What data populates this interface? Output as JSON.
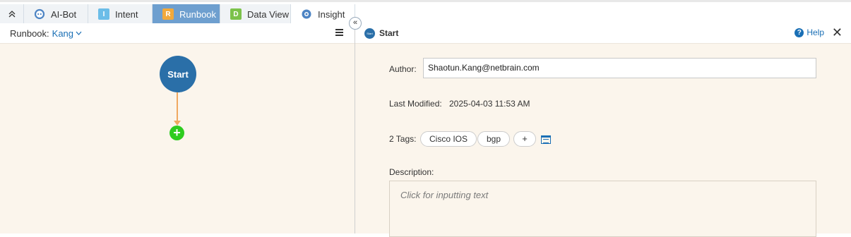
{
  "tabs": [
    {
      "label": "AI-Bot",
      "icon": "ai-bot-icon"
    },
    {
      "label": "Intent",
      "icon": "intent-icon",
      "badge": "I"
    },
    {
      "label": "Runbook",
      "icon": "runbook-icon",
      "badge": "R"
    },
    {
      "label": "Data View",
      "icon": "data-view-icon",
      "badge": "D"
    },
    {
      "label": "Insight",
      "icon": "insight-icon"
    }
  ],
  "left": {
    "runbook_label": "Runbook:",
    "runbook_value": "Kang",
    "start_node": "Start",
    "add_node": "+"
  },
  "right": {
    "title": "Start",
    "small_icon_text": "Start",
    "help": "Help",
    "close": "✕",
    "author_label": "Author:",
    "author_value": "Shaotun.Kang@netbrain.com",
    "last_modified_label": "Last Modified:",
    "last_modified_value": "2025-04-03 11:53 AM",
    "tags_label": "2 Tags:",
    "tags": [
      "Cisco IOS",
      "bgp"
    ],
    "tag_add": "+",
    "description_label": "Description:",
    "description_placeholder": "Click for inputting text"
  },
  "colors": {
    "accent": "#1a6fb5",
    "active_tab": "#6e9fcf",
    "start_node": "#2a6fa8",
    "add_node": "#2ecc1f",
    "connector": "#f0a860",
    "canvas_bg": "#fbf5ec"
  }
}
